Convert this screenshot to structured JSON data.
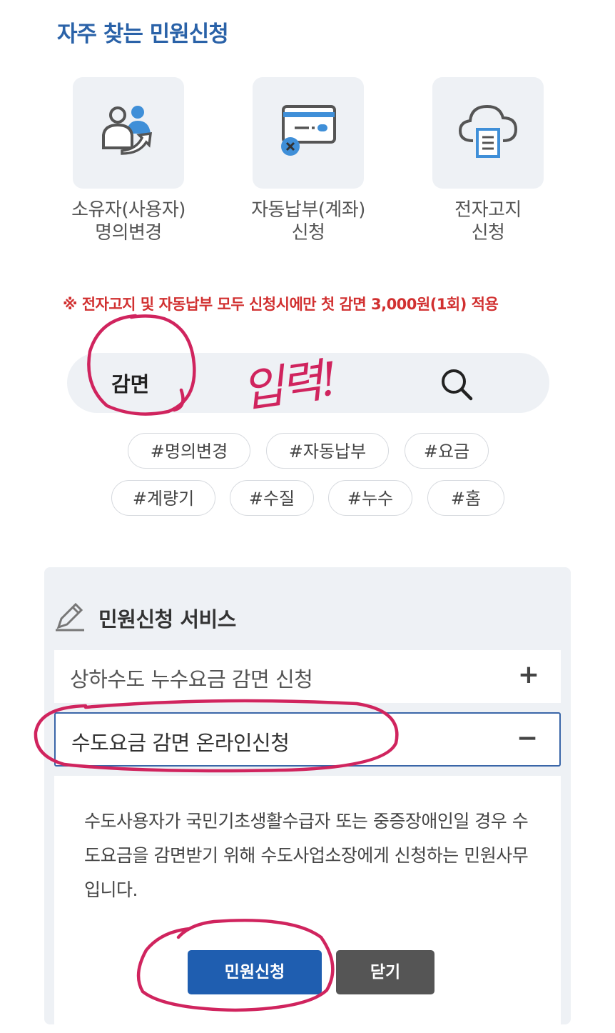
{
  "section_title": "자주 찾는 민원신청",
  "quick_links": [
    {
      "line1": "소유자(사용자)",
      "line2": "명의변경",
      "icon": "person-transfer-icon"
    },
    {
      "line1": "자동납부(계좌)",
      "line2": "신청",
      "icon": "card-payment-icon"
    },
    {
      "line1": "전자고지",
      "line2": "신청",
      "icon": "cloud-document-icon"
    }
  ],
  "notice": "※ 전자고지 및 자동납부 모두 신청시에만 첫 감면 3,000원(1회) 적용",
  "search": {
    "value": "감면",
    "icon": "search-icon"
  },
  "tags": [
    "#명의변경",
    "#자동납부",
    "#요금",
    "#계량기",
    "#수질",
    "#누수",
    "#홈"
  ],
  "services": {
    "title": "민원신청 서비스",
    "items": [
      {
        "label": "상하수도 누수요금 감면 신청",
        "sign": "+"
      },
      {
        "label": "수도요금 감면 온라인신청",
        "sign": "−"
      }
    ],
    "description": "수도사용자가 국민기초생활수급자 또는 중증장애인일 경우 수도요금을 감면받기 위해 수도사업소장에게 신청하는 민원사무입니다.",
    "apply_button": "민원신청",
    "close_button": "닫기"
  },
  "handwriting": "입력!",
  "colors": {
    "title_blue": "#2a62a8",
    "notice_red": "#d13030",
    "apply_blue": "#1f5eb0",
    "close_gray": "#555555",
    "annotation": "#d0245e"
  }
}
